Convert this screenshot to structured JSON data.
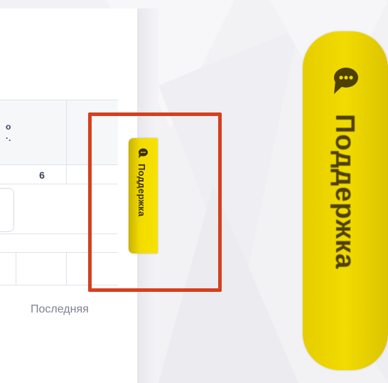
{
  "table": {
    "header_fragment_line1": "о",
    "header_fragment_line2": "·.",
    "column_number": "6",
    "pagination_last_label": "Последняя"
  },
  "support_tab_small": {
    "label": "Поддержка",
    "icon": "chat-bubble-icon"
  },
  "support_tab_zoomed": {
    "label": "Поддержка",
    "icon": "chat-bubble-icon"
  },
  "colors": {
    "support_yellow": "#f2dc00",
    "highlight_red": "#d5401e",
    "text_dark": "#3b4260",
    "text_muted": "#7d8291"
  }
}
